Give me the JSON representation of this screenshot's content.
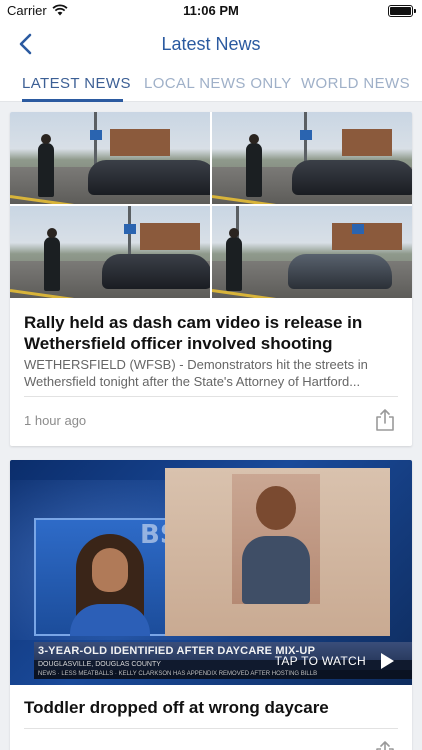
{
  "status_bar": {
    "carrier": "Carrier",
    "time": "11:06 PM"
  },
  "nav": {
    "title": "Latest News",
    "back_icon": "chevron-left-icon"
  },
  "tabs": [
    {
      "label": "LATEST NEWS",
      "active": true
    },
    {
      "label": "LOCAL NEWS ONLY",
      "active": false
    },
    {
      "label": "WORLD NEWS",
      "active": false
    }
  ],
  "colors": {
    "accent": "#2b5aa0",
    "tab_inactive": "#9fb0c8",
    "background": "#eef0f3"
  },
  "articles": [
    {
      "headline": "Rally held as dash cam video is release in Wethersfield officer involved shooting",
      "summary": "WETHERSFIELD (WFSB) - Demonstrators hit the streets in Wethersfield tonight after the State's Attorney of Hartford...",
      "time_ago": "1 hour ago",
      "share_icon": "share-icon"
    },
    {
      "headline": "Toddler dropped off at wrong daycare",
      "video": {
        "ticker": "3-YEAR-OLD IDENTIFIED AFTER DAYCARE MIX-UP",
        "ticker_location": "DOUGLASVILLE, DOUGLAS COUNTY",
        "ticker_bottom": "NEWS · LESS MEATBALLS · KELLY CLARKSON HAS APPENDIX REMOVED AFTER HOSTING BILLB",
        "logo_text": "BS",
        "tap_label": "TAP TO WATCH",
        "play_icon": "play-icon"
      }
    }
  ]
}
